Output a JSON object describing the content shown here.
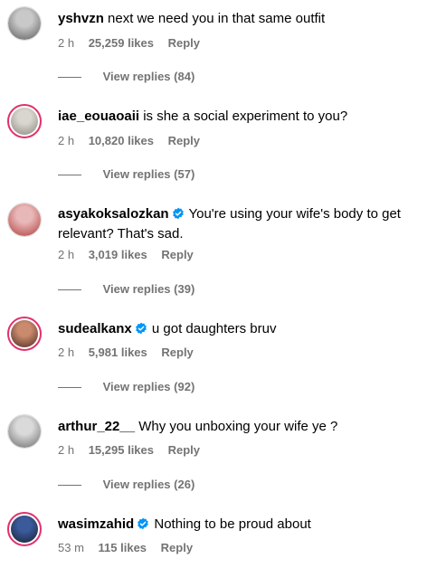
{
  "comments": [
    {
      "username": "yshvzn",
      "verified": false,
      "text": "next we need you in that same outfit",
      "time": "2 h",
      "likes": "25,259 likes",
      "reply": "Reply",
      "view_replies": "View replies (84)",
      "avatar": {
        "ring": false,
        "colors": [
          "#c9c9c9",
          "#5a5a5a"
        ]
      }
    },
    {
      "username": "iae_eouaoaii",
      "verified": false,
      "text": "is she a social experiment to you?",
      "time": "2 h",
      "likes": "10,820 likes",
      "reply": "Reply",
      "view_replies": "View replies (57)",
      "avatar": {
        "ring": true,
        "colors": [
          "#d9d6cf",
          "#8a877f"
        ]
      }
    },
    {
      "username": "asyakoksalozkan",
      "verified": true,
      "text": "You're using your wife's body to get relevant? That's sad.",
      "time": "2 h",
      "likes": "3,019 likes",
      "reply": "Reply",
      "view_replies": "View replies (39)",
      "avatar": {
        "ring": false,
        "colors": [
          "#e8b7b7",
          "#b03a3a"
        ]
      }
    },
    {
      "username": "sudealkanx",
      "verified": true,
      "text": "u got daughters bruv",
      "time": "2 h",
      "likes": "5,981 likes",
      "reply": "Reply",
      "view_replies": "View replies (92)",
      "avatar": {
        "ring": true,
        "colors": [
          "#c98a6e",
          "#4a2a20"
        ]
      }
    },
    {
      "username": "arthur_22__",
      "verified": false,
      "text": "Why you unboxing your wife ye ?",
      "time": "2 h",
      "likes": "15,295 likes",
      "reply": "Reply",
      "view_replies": "View replies (26)",
      "avatar": {
        "ring": false,
        "colors": [
          "#dadada",
          "#6a6a6a"
        ]
      }
    },
    {
      "username": "wasimzahid",
      "verified": true,
      "text": "Nothing to be proud about",
      "time": "53 m",
      "likes": "115 likes",
      "reply": "Reply",
      "view_replies": "",
      "avatar": {
        "ring": true,
        "colors": [
          "#3a5a9a",
          "#1a2030"
        ]
      }
    }
  ],
  "colors": {
    "verified": "#0095f6",
    "muted": "#737373",
    "ring": "#e1306c"
  }
}
